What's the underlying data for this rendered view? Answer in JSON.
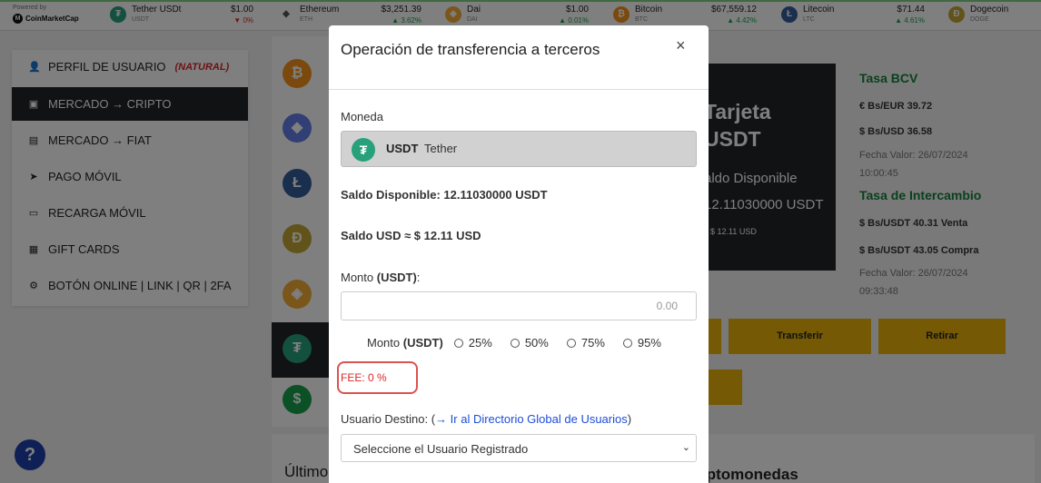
{
  "ticker": {
    "powered_by": "Powered by",
    "brand": "CoinMarketCap",
    "items": [
      {
        "name": "Tether USDt",
        "symbol": "USDT",
        "price": "$1.00",
        "change": "▼ 0%",
        "dir": "down",
        "color": "#26a17b",
        "glyph": "₮"
      },
      {
        "name": "Ethereum",
        "symbol": "ETH",
        "price": "$3,251.39",
        "change": "▲ 3.62%",
        "dir": "up",
        "color": "#627eea",
        "glyph": "◆"
      },
      {
        "name": "Dai",
        "symbol": "DAI",
        "price": "$1.00",
        "change": "▲ 0.01%",
        "dir": "up",
        "color": "#f5ac37",
        "glyph": "◈"
      },
      {
        "name": "Bitcoin",
        "symbol": "BTC",
        "price": "$67,559.12",
        "change": "▲ 4.42%",
        "dir": "up",
        "color": "#f7931a",
        "glyph": "₿"
      },
      {
        "name": "Litecoin",
        "symbol": "LTC",
        "price": "$71.44",
        "change": "▲ 4.61%",
        "dir": "up",
        "color": "#345d9d",
        "glyph": "Ł"
      },
      {
        "name": "Dogecoin",
        "symbol": "DOGE",
        "price": "",
        "change": "",
        "dir": "up",
        "color": "#c2a633",
        "glyph": "Ð"
      }
    ]
  },
  "sidebar": {
    "items": [
      {
        "label": "Perfil de Usuario",
        "tag": "(NATURAL)",
        "icon": "user-icon"
      },
      {
        "label": "Mercado → Cripto",
        "icon": "wallet-icon"
      },
      {
        "label": "Mercado → Fiat",
        "icon": "money-icon"
      },
      {
        "label": "Pago Móvil",
        "icon": "send-icon"
      },
      {
        "label": "Recarga Móvil",
        "icon": "card-icon"
      },
      {
        "label": "Gift Cards",
        "icon": "gift-icon"
      },
      {
        "label": "Botón Online | Link | QR | 2FA",
        "icon": "gear-icon"
      }
    ]
  },
  "background_card": {
    "line1": "Tarjeta",
    "line2": "USDT",
    "balance_label": "aldo Disponible",
    "balance": "12.11030000 USDT",
    "usd": "$ 12.11 USD"
  },
  "rates": {
    "bcv_title": "Tasa BCV",
    "eur": "€ Bs/EUR  39.72",
    "usd": "$ Bs/USD  36.58",
    "date1": "Fecha Valor: 26/07/2024",
    "time1": "10:00:45",
    "exchange_title": "Tasa de Intercambio",
    "sell": "$ Bs/USDT  40.31 Venta",
    "buy": "$ Bs/USDT  43.05 Compra",
    "date2": "Fecha Valor: 26/07/2024",
    "time2": "09:33:48"
  },
  "buttons": {
    "transfer": "Transferir",
    "withdraw": "Retirar"
  },
  "bottom": {
    "left": "Último",
    "right": "iptomonedas"
  },
  "modal": {
    "title": "Operación de transferencia a terceros",
    "close": "×",
    "currency_label": "Moneda",
    "coin_symbol": "USDT",
    "coin_name": "Tether",
    "balance_line": "Saldo Disponible: 12.11030000 USDT",
    "usd_line": "Saldo USD ≈ $ 12.11 USD",
    "amount_label": "Monto ",
    "amount_unit": "(USDT)",
    "amount_colon": ":",
    "amount_placeholder": "0.00",
    "pct_label": "Monto ",
    "pct_unit": "(USDT)",
    "percentages": [
      "25%",
      "50%",
      "75%",
      "95%"
    ],
    "fee": "FEE: 0 %",
    "dest_label": "Usuario Destino: (",
    "dest_link": "→ Ir al Directorio Global de Usuarios",
    "dest_close": ")",
    "select_value": "Seleccione el Usuario Registrado"
  }
}
